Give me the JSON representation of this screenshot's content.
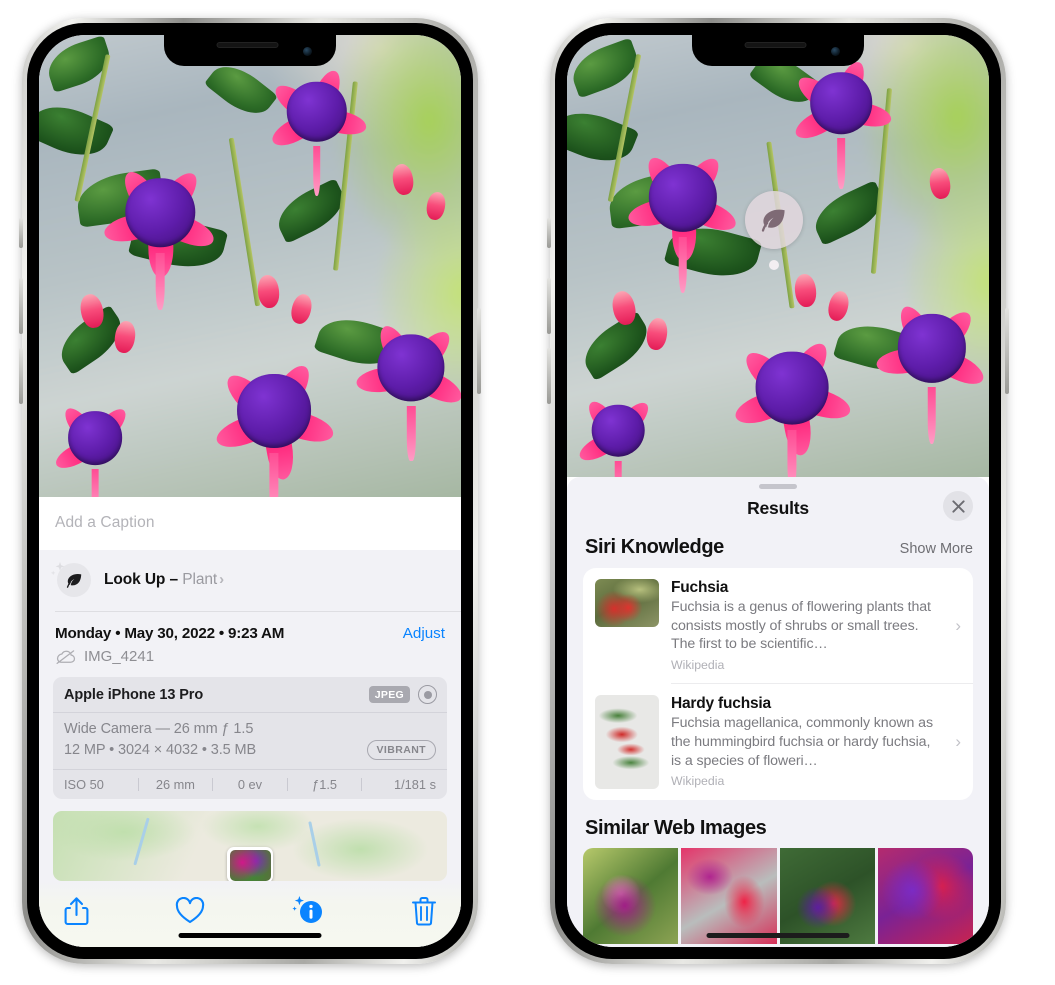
{
  "left_phone": {
    "caption_placeholder": "Add a Caption",
    "lookup": {
      "label": "Look Up – ",
      "subject": "Plant",
      "chevron": "›",
      "icon": "leaf-icon"
    },
    "metadata": {
      "date_line": "Monday • May 30, 2022 • 9:23 AM",
      "adjust_label": "Adjust",
      "filename": "IMG_4241",
      "cloud_icon": "cloud-slash-icon"
    },
    "camera_card": {
      "device": "Apple iPhone 13 Pro",
      "format_badge": "JPEG",
      "aperture_icon": "aperture-icon",
      "lens_line": "Wide Camera — 26 mm ƒ 1.5",
      "size_line": "12 MP • 3024 × 4032 • 3.5 MB",
      "style_badge": "VIBRANT",
      "exif": [
        "ISO 50",
        "26 mm",
        "0 ev",
        "ƒ1.5",
        "1/181 s"
      ]
    },
    "toolbar": [
      {
        "name": "share-button",
        "icon": "share-icon"
      },
      {
        "name": "favorite-button",
        "icon": "heart-icon"
      },
      {
        "name": "info-button",
        "icon": "info-sparkle-icon"
      },
      {
        "name": "delete-button",
        "icon": "trash-icon"
      }
    ]
  },
  "right_phone": {
    "visual_lookup_badge": {
      "icon": "leaf-icon"
    },
    "sheet": {
      "title": "Results",
      "close_label": "✕",
      "section_title": "Siri Knowledge",
      "show_more": "Show More",
      "knowledge_items": [
        {
          "title": "Fuchsia",
          "description": "Fuchsia is a genus of flowering plants that consists mostly of shrubs or small trees. The first to be scientific…",
          "source": "Wikipedia",
          "chevron": "›"
        },
        {
          "title": "Hardy fuchsia",
          "description": "Fuchsia magellanica, commonly known as the hummingbird fuchsia or hardy fuchsia, is a species of floweri…",
          "source": "Wikipedia",
          "chevron": "›"
        }
      ],
      "similar_title": "Similar Web Images"
    }
  },
  "colors": {
    "accent_blue": "#0a84ff",
    "sheet_bg": "#f2f2f7",
    "card_bg": "#ffffff",
    "secondary_text": "#8e8e93"
  }
}
